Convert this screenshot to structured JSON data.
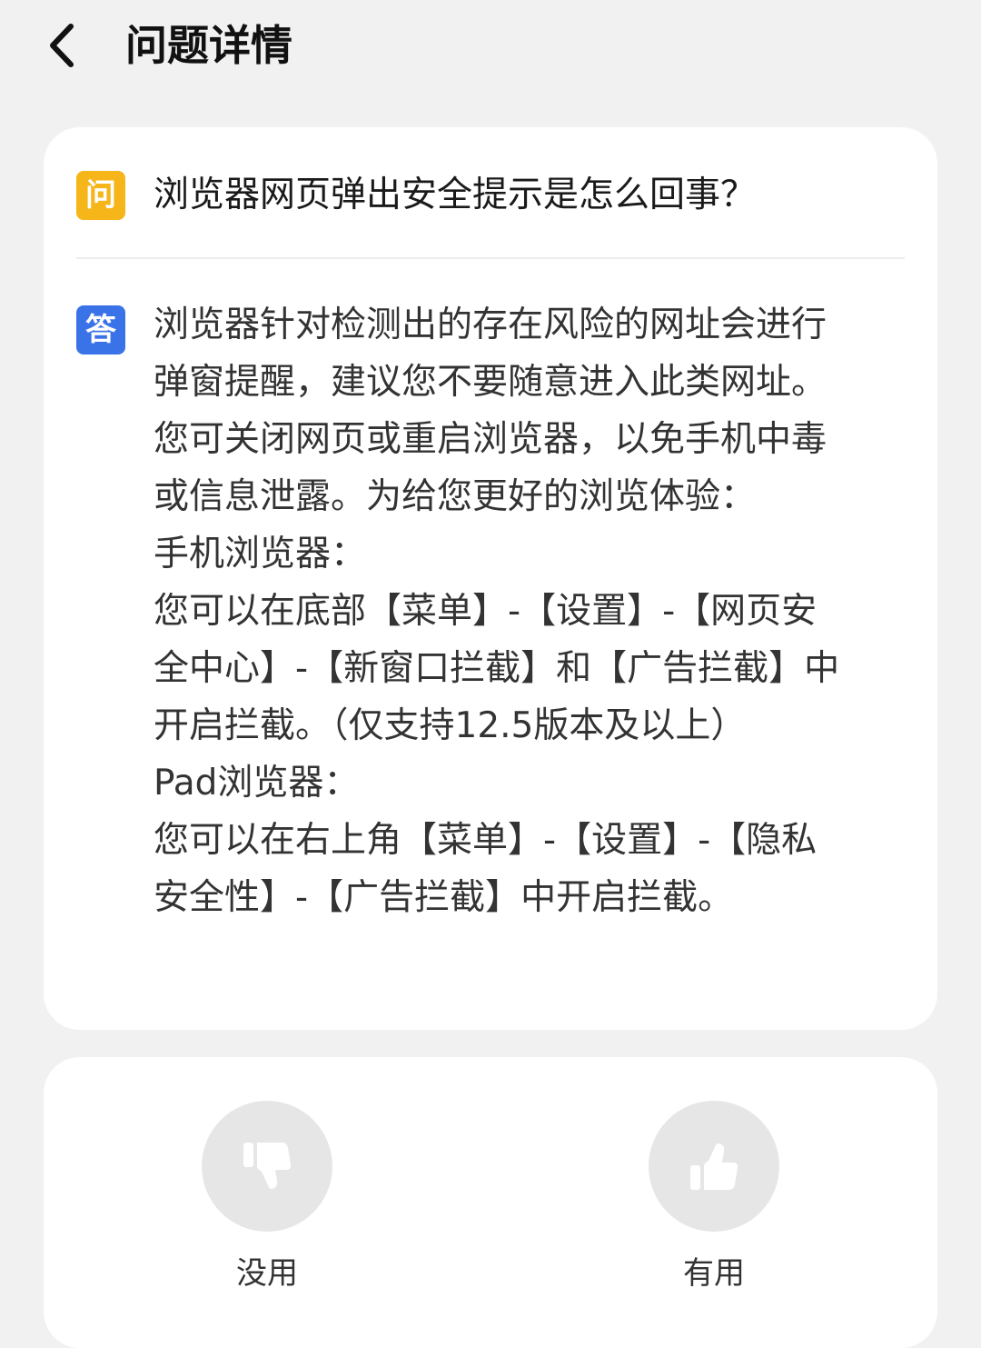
{
  "header": {
    "back_icon": "chevron-left-icon",
    "title": "问题详情"
  },
  "qa": {
    "question_badge": "问",
    "question": "浏览器网页弹出安全提示是怎么回事？",
    "answer_badge": "答",
    "answer_lines": [
      "浏览器针对检测出的存在风险的网址会进行",
      "弹窗提醒，建议您不要随意进入此类网址。",
      "您可关闭网页或重启浏览器，以免手机中毒",
      "或信息泄露。为给您更好的浏览体验：",
      "手机浏览器：",
      "您可以在底部【菜单】-【设置】-【网页安",
      "全中心】-【新窗口拦截】和【广告拦截】中",
      "开启拦截。（仅支持12.5版本及以上）",
      "Pad浏览器：",
      "您可以在右上角【菜单】-【设置】-【隐私",
      "安全性】-【广告拦截】中开启拦截。"
    ],
    "colors": {
      "question_badge": "#f6b518",
      "answer_badge": "#3a72e8"
    }
  },
  "feedback": {
    "useless_label": "没用",
    "useless_icon": "thumbs-down-icon",
    "useful_label": "有用",
    "useful_icon": "thumbs-up-icon"
  }
}
